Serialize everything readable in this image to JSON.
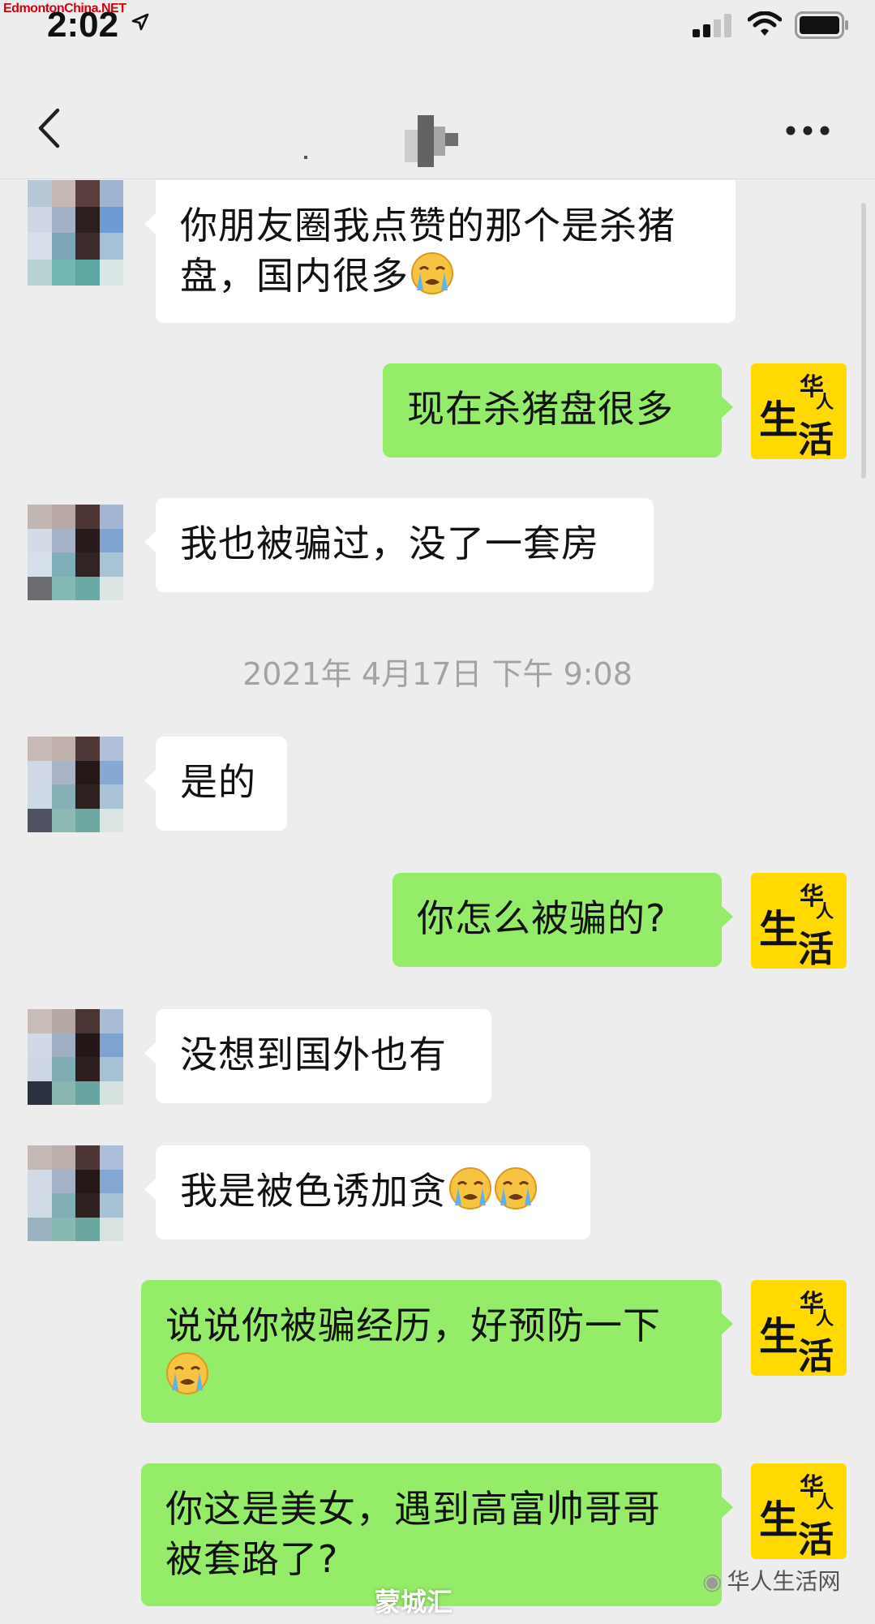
{
  "watermark": "EdmontonChina.NET",
  "status_bar": {
    "time": "2:02"
  },
  "nav": {
    "contact_name": ""
  },
  "timestamp": "2021年 4月17日 下午 9:08",
  "messages": [
    {
      "from": "other",
      "text": "你朋友圈我点赞的那个是杀猪盘，国内很多",
      "emojis": 1
    },
    {
      "from": "me",
      "text": "现在杀猪盘很多",
      "emojis": 0
    },
    {
      "from": "other",
      "text": "我也被骗过，没了一套房",
      "emojis": 0
    },
    {
      "from": "other",
      "text": "是的",
      "emojis": 0
    },
    {
      "from": "me",
      "text": "你怎么被骗的?",
      "emojis": 0
    },
    {
      "from": "other",
      "text": "没想到国外也有",
      "emojis": 0
    },
    {
      "from": "other",
      "text": "我是被色诱加贪",
      "emojis": 2
    },
    {
      "from": "me",
      "text": "说说你被骗经历，好预防一下",
      "emojis": 1
    },
    {
      "from": "me",
      "text": "你这是美女，遇到高富帅哥哥被套路了?",
      "emojis": 0
    }
  ],
  "brand_avatar": {
    "chars": [
      "生",
      "活",
      "华",
      "人"
    ]
  },
  "footer": {
    "watermark": "蒙城汇",
    "source": "华人生活网"
  },
  "colors": {
    "outgoing_bubble": "#95ec69",
    "incoming_bubble": "#ffffff",
    "background": "#ededed",
    "brand_yellow": "#ffd900"
  },
  "icons": [
    "location-arrow-icon",
    "signal-icon",
    "wifi-icon",
    "battery-icon",
    "back-icon",
    "more-icon",
    "sob-emoji-icon"
  ]
}
